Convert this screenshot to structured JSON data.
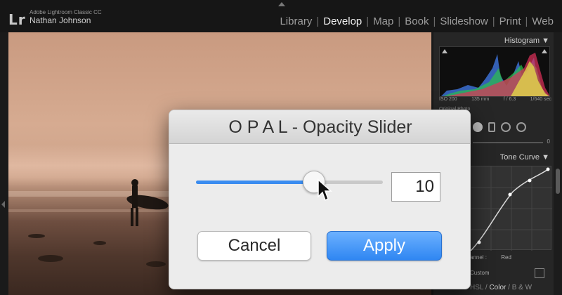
{
  "app": {
    "logo": "Lr",
    "product": "Adobe Lightroom Classic CC",
    "user": "Nathan Johnson"
  },
  "modules": [
    {
      "label": "Library",
      "active": false
    },
    {
      "label": "Develop",
      "active": true
    },
    {
      "label": "Map",
      "active": false
    },
    {
      "label": "Book",
      "active": false
    },
    {
      "label": "Slideshow",
      "active": false
    },
    {
      "label": "Print",
      "active": false
    },
    {
      "label": "Web",
      "active": false
    }
  ],
  "right_panel": {
    "histogram_title": "Histogram",
    "iso": "ISO 200",
    "focal": "135 mm",
    "aperture": "f / 6.3",
    "shutter": "1/640 sec",
    "original_photo": "Original Photo",
    "slider_value": "0",
    "tone_curve_title": "Tone Curve",
    "channel_label": "annel :",
    "channel_value": "Red",
    "custom_label": "Custom",
    "tabs": {
      "hsl": "HSL",
      "sep1": " / ",
      "color": "Color",
      "sep2": " / ",
      "bw": "B & W"
    }
  },
  "dialog": {
    "title": "O P A L - Opacity Slider",
    "slider_fraction": 0.63,
    "value": "10",
    "cancel_label": "Cancel",
    "apply_label": "Apply"
  },
  "colors": {
    "accent": "#3a8cf0",
    "panel_bg": "#262626"
  }
}
